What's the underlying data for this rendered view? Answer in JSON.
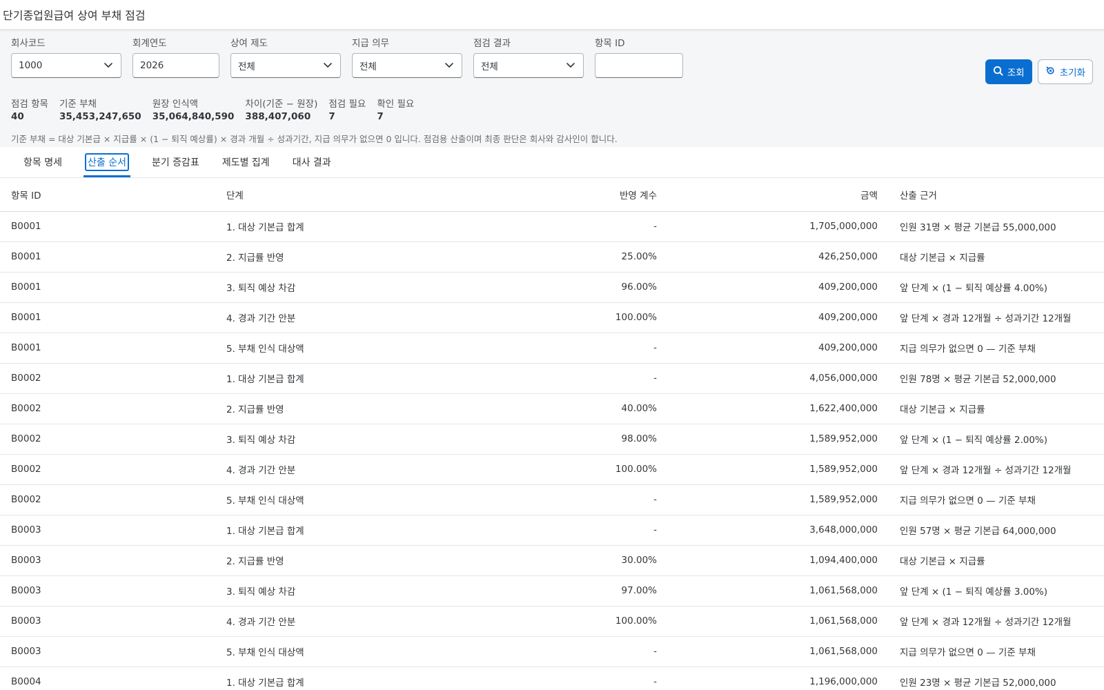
{
  "header": {
    "title": "단기종업원급여 상여 부채 점검"
  },
  "filters": [
    {
      "label": "회사코드",
      "value": "1000",
      "type": "select",
      "width": 160
    },
    {
      "label": "회계연도",
      "value": "2026",
      "type": "input",
      "width": 126
    },
    {
      "label": "상여 제도",
      "value": "전체",
      "type": "select",
      "width": 160
    },
    {
      "label": "지급 의무",
      "value": "전체",
      "type": "select",
      "width": 160
    },
    {
      "label": "점검 결과",
      "value": "전체",
      "type": "select",
      "width": 160
    },
    {
      "label": "항목 ID",
      "value": "",
      "type": "input",
      "width": 128
    }
  ],
  "actions": {
    "search_label": "조회",
    "reset_label": "초기화"
  },
  "kpis": [
    {
      "label": "점검 항목",
      "value": "40"
    },
    {
      "label": "기준 부채",
      "value": "35,453,247,650"
    },
    {
      "label": "원장 인식액",
      "value": "35,064,840,590"
    },
    {
      "label": "차이(기준 − 원장)",
      "value": "388,407,060"
    },
    {
      "label": "점검 필요",
      "value": "7"
    },
    {
      "label": "확인 필요",
      "value": "7"
    }
  ],
  "note": "기준 부채 = 대상 기본급 × 지급률 × (1 − 퇴직 예상률) × 경과 개월 ÷ 성과기간, 지급 의무가 없으면 0 입니다. 점검용 산출이며 최종 판단은 회사와 감사인이 합니다.",
  "tabs": [
    {
      "label": "항목 명세",
      "active": false
    },
    {
      "label": "산출 순서",
      "active": true
    },
    {
      "label": "분기 증감표",
      "active": false
    },
    {
      "label": "제도별 집계",
      "active": false
    },
    {
      "label": "대사 결과",
      "active": false
    }
  ],
  "table": {
    "columns": [
      "항목 ID",
      "단계",
      "반영 계수",
      "금액",
      "산출 근거"
    ],
    "rows": [
      [
        "B0001",
        "1. 대상 기본급 합계",
        "-",
        "1,705,000,000",
        "인원 31명 × 평균 기본급 55,000,000"
      ],
      [
        "B0001",
        "2. 지급률 반영",
        "25.00%",
        "426,250,000",
        "대상 기본급 × 지급률"
      ],
      [
        "B0001",
        "3. 퇴직 예상 차감",
        "96.00%",
        "409,200,000",
        "앞 단계 × (1 − 퇴직 예상률 4.00%)"
      ],
      [
        "B0001",
        "4. 경과 기간 안분",
        "100.00%",
        "409,200,000",
        "앞 단계 × 경과 12개월 ÷ 성과기간 12개월"
      ],
      [
        "B0001",
        "5. 부채 인식 대상액",
        "-",
        "409,200,000",
        "지급 의무가 없으면 0 — 기준 부채"
      ],
      [
        "B0002",
        "1. 대상 기본급 합계",
        "-",
        "4,056,000,000",
        "인원 78명 × 평균 기본급 52,000,000"
      ],
      [
        "B0002",
        "2. 지급률 반영",
        "40.00%",
        "1,622,400,000",
        "대상 기본급 × 지급률"
      ],
      [
        "B0002",
        "3. 퇴직 예상 차감",
        "98.00%",
        "1,589,952,000",
        "앞 단계 × (1 − 퇴직 예상률 2.00%)"
      ],
      [
        "B0002",
        "4. 경과 기간 안분",
        "100.00%",
        "1,589,952,000",
        "앞 단계 × 경과 12개월 ÷ 성과기간 12개월"
      ],
      [
        "B0002",
        "5. 부채 인식 대상액",
        "-",
        "1,589,952,000",
        "지급 의무가 없으면 0 — 기준 부채"
      ],
      [
        "B0003",
        "1. 대상 기본급 합계",
        "-",
        "3,648,000,000",
        "인원 57명 × 평균 기본급 64,000,000"
      ],
      [
        "B0003",
        "2. 지급률 반영",
        "30.00%",
        "1,094,400,000",
        "대상 기본급 × 지급률"
      ],
      [
        "B0003",
        "3. 퇴직 예상 차감",
        "97.00%",
        "1,061,568,000",
        "앞 단계 × (1 − 퇴직 예상률 3.00%)"
      ],
      [
        "B0003",
        "4. 경과 기간 안분",
        "100.00%",
        "1,061,568,000",
        "앞 단계 × 경과 12개월 ÷ 성과기간 12개월"
      ],
      [
        "B0003",
        "5. 부채 인식 대상액",
        "-",
        "1,061,568,000",
        "지급 의무가 없으면 0 — 기준 부채"
      ],
      [
        "B0004",
        "1. 대상 기본급 합계",
        "-",
        "1,196,000,000",
        "인원 23명 × 평균 기본급 52,000,000"
      ]
    ]
  }
}
